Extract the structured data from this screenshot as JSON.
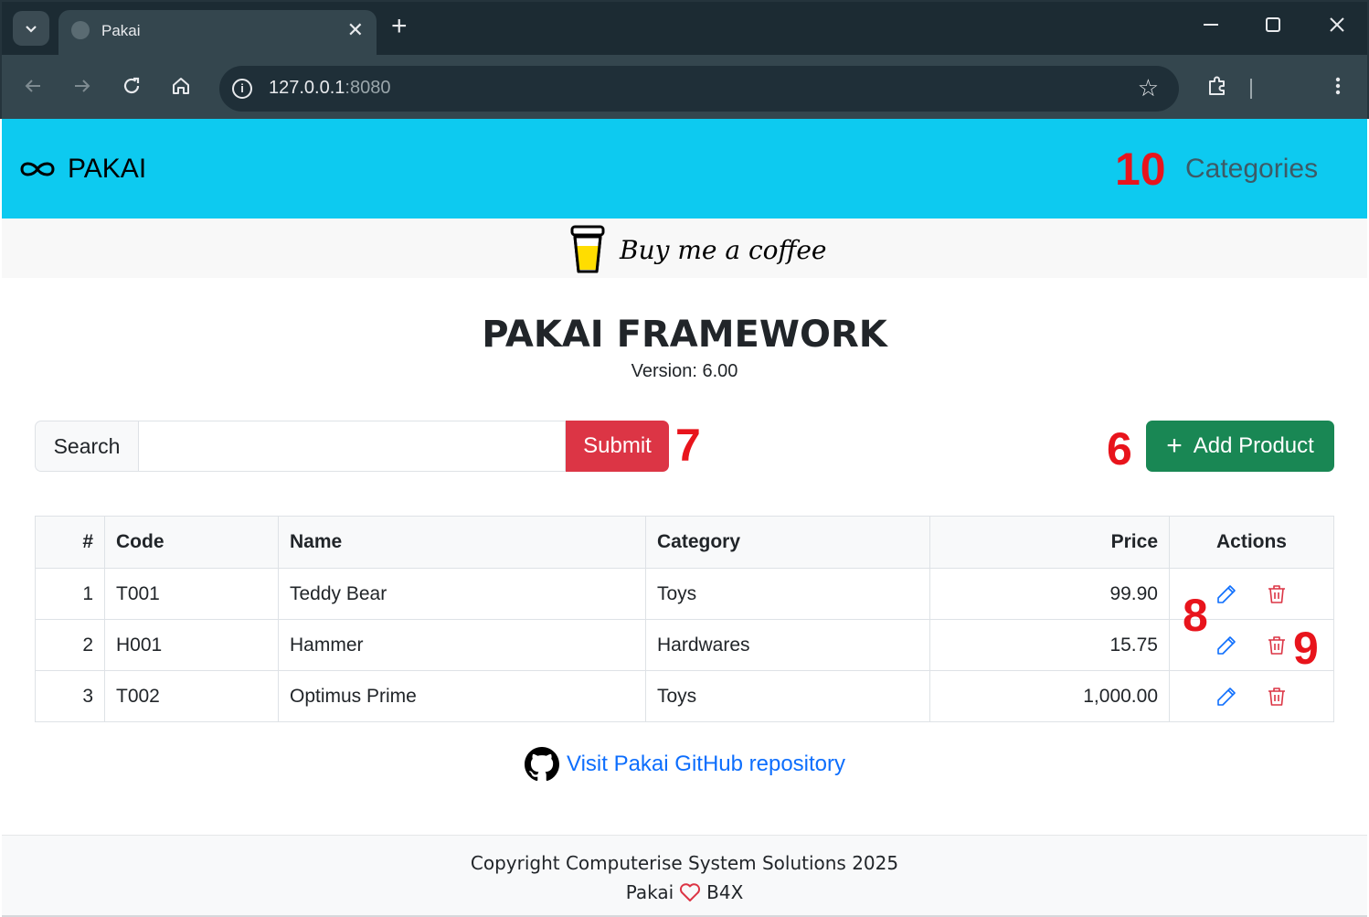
{
  "browser": {
    "tab_title": "Pakai",
    "url_host": "127.0.0.1",
    "url_port": ":8080"
  },
  "navbar": {
    "brand": "PAKAI",
    "categories_link": "Categories"
  },
  "banner": {
    "coffee_text": "Buy me a coffee"
  },
  "header": {
    "title": "PAKAI FRAMEWORK",
    "version": "Version: 6.00"
  },
  "search": {
    "label": "Search",
    "value": "",
    "submit_label": "Submit"
  },
  "add_product_label": "Add Product",
  "annotations": {
    "categories": "10",
    "submit": "7",
    "add_product": "6",
    "edit": "8",
    "delete": "9"
  },
  "table": {
    "headers": {
      "num": "#",
      "code": "Code",
      "name": "Name",
      "category": "Category",
      "price": "Price",
      "actions": "Actions"
    },
    "rows": [
      {
        "num": "1",
        "code": "T001",
        "name": "Teddy Bear",
        "category": "Toys",
        "price": "99.90"
      },
      {
        "num": "2",
        "code": "H001",
        "name": "Hammer",
        "category": "Hardwares",
        "price": "15.75"
      },
      {
        "num": "3",
        "code": "T002",
        "name": "Optimus Prime",
        "category": "Toys",
        "price": "1,000.00"
      }
    ]
  },
  "github_link": "Visit Pakai GitHub repository",
  "footer": {
    "copyright": "Copyright Computerise System Solutions 2025",
    "left": "Pakai",
    "right": "B4X"
  },
  "colors": {
    "navbar": "#0dcaf0",
    "submit": "#dc3545",
    "add_product": "#198754",
    "link": "#0d6efd",
    "annotation": "#e8141c"
  }
}
